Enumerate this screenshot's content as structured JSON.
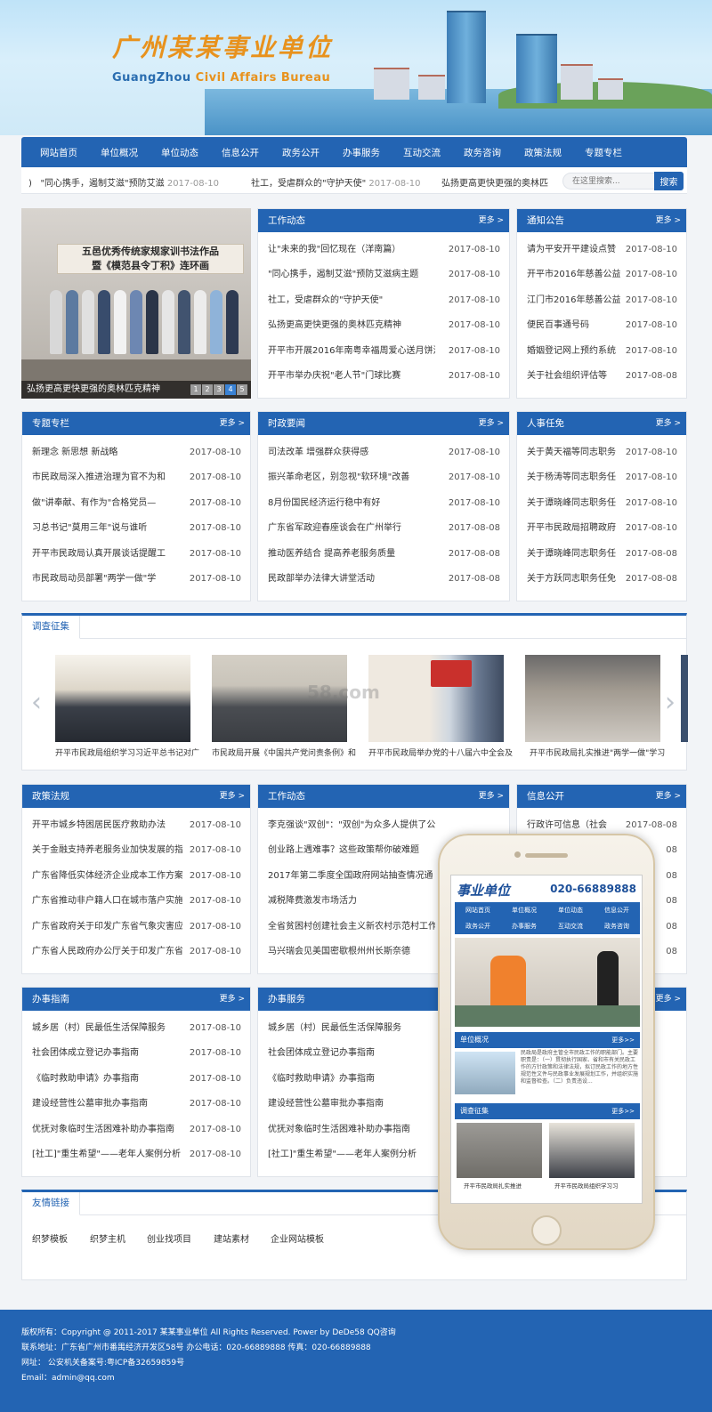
{
  "site": {
    "logo_cn": "广州某某事业单位",
    "logo_en_a": "GuangZhou",
    "logo_en_b": " Civil Affairs Bureau"
  },
  "nav": [
    "网站首页",
    "单位概况",
    "单位动态",
    "信息公开",
    "政务公开",
    "办事服务",
    "互动交流",
    "政务咨询",
    "政策法规",
    "专题专栏"
  ],
  "ticker": [
    {
      "title": "\"同心携手，遏制艾滋\"预防艾滋",
      "date": "2017-08-10"
    },
    {
      "title": "社工，受虐群众的\"守护天使\"",
      "date": "2017-08-10"
    },
    {
      "title": "弘扬更高更快更强的奥林匹",
      "date": ""
    }
  ],
  "search": {
    "placeholder": "在这里搜索...",
    "button": "搜索"
  },
  "slideshow": {
    "banner_line1": "五邑优秀传统家规家训书法作品",
    "banner_line2": "暨《模范县令丁积》连环画",
    "caption": "弘扬更高更快更强的奥林匹克精神",
    "pages": [
      "1",
      "2",
      "3",
      "4",
      "5"
    ],
    "active_page": "4"
  },
  "more_label": "更多 >",
  "panels": {
    "gzdt": {
      "title": "工作动态",
      "items": [
        {
          "t": "让\"未来的我\"回忆现在（洋南篇）",
          "d": "2017-08-10"
        },
        {
          "t": "\"同心携手，遏制艾滋\"预防艾滋病主题",
          "d": "2017-08-10"
        },
        {
          "t": "社工，受虐群众的\"守护天使\"",
          "d": "2017-08-10"
        },
        {
          "t": "弘扬更高更快更强的奥林匹克精神",
          "d": "2017-08-10"
        },
        {
          "t": "开平市开展2016年南粤幸福周爱心送月饼活",
          "d": "2017-08-10"
        },
        {
          "t": "开平市举办庆祝\"老人节\"门球比赛",
          "d": "2017-08-10"
        }
      ]
    },
    "tzgg": {
      "title": "通知公告",
      "items": [
        {
          "t": "请为平安开平建设点赞",
          "d": "2017-08-10"
        },
        {
          "t": "开平市2016年慈善公益",
          "d": "2017-08-10"
        },
        {
          "t": "江门市2016年慈善公益",
          "d": "2017-08-10"
        },
        {
          "t": "便民百事通号码",
          "d": "2017-08-10"
        },
        {
          "t": "婚姻登记网上预约系统",
          "d": "2017-08-10"
        },
        {
          "t": "关于社会组织评估等",
          "d": "2017-08-08"
        }
      ]
    },
    "ztzl": {
      "title": "专题专栏",
      "items": [
        {
          "t": "新理念 新思想 新战略",
          "d": "2017-08-10"
        },
        {
          "t": "市民政局深入推进治理为官不为和",
          "d": "2017-08-10"
        },
        {
          "t": "做\"讲奉献、有作为\"合格党员—",
          "d": "2017-08-10"
        },
        {
          "t": "习总书记\"莫用三年\"说与谁听",
          "d": "2017-08-10"
        },
        {
          "t": "开平市民政局认真开展谈话提醒工",
          "d": "2017-08-10"
        },
        {
          "t": "市民政局动员部署\"两学一做\"学",
          "d": "2017-08-10"
        }
      ]
    },
    "szyw": {
      "title": "时政要闻",
      "items": [
        {
          "t": "司法改革 增强群众获得感",
          "d": "2017-08-10"
        },
        {
          "t": "振兴革命老区，别忽视\"软环境\"改善",
          "d": "2017-08-10"
        },
        {
          "t": "8月份国民经济运行稳中有好",
          "d": "2017-08-10"
        },
        {
          "t": "广东省军政迎春座谈会在广州举行",
          "d": "2017-08-08"
        },
        {
          "t": "推动医养结合 提高养老服务质量",
          "d": "2017-08-08"
        },
        {
          "t": "民政部举办法律大讲堂活动",
          "d": "2017-08-08"
        }
      ]
    },
    "rsrm": {
      "title": "人事任免",
      "items": [
        {
          "t": "关于黄天福等同志职务",
          "d": "2017-08-10"
        },
        {
          "t": "关于杨涛等同志职务任",
          "d": "2017-08-10"
        },
        {
          "t": "关于谭晓峰同志职务任",
          "d": "2017-08-10"
        },
        {
          "t": "开平市民政局招聘政府",
          "d": "2017-08-10"
        },
        {
          "t": "关于谭晓峰同志职务任",
          "d": "2017-08-08"
        },
        {
          "t": "关于方跃同志职务任免",
          "d": "2017-08-08"
        }
      ]
    },
    "zcfg": {
      "title": "政策法规",
      "items": [
        {
          "t": "开平市城乡特困居民医疗救助办法",
          "d": "2017-08-10"
        },
        {
          "t": "关于金融支持养老服务业加快发展的指",
          "d": "2017-08-10"
        },
        {
          "t": "广东省降低实体经济企业成本工作方案",
          "d": "2017-08-10"
        },
        {
          "t": "广东省推动非户籍人口在城市落户实施",
          "d": "2017-08-10"
        },
        {
          "t": "广东省政府关于印发广东省气象灾害应",
          "d": "2017-08-10"
        },
        {
          "t": "广东省人民政府办公厅关于印发广东省",
          "d": "2017-08-10"
        }
      ]
    },
    "gzdt2": {
      "title": "工作动态",
      "items": [
        {
          "t": "李克强谈\"双创\"：\"双创\"为众多人提供了公平竞争的机会",
          "d": ""
        },
        {
          "t": "创业路上遇难事？这些政策帮你破难题",
          "d": ""
        },
        {
          "t": "2017年第二季度全国政府网站抽查情况通",
          "d": ""
        },
        {
          "t": "减税降费激发市场活力",
          "d": ""
        },
        {
          "t": "全省贫困村创建社会主义新农村示范村工作",
          "d": ""
        },
        {
          "t": "马兴瑞会见美国密歇根州州长斯奈德",
          "d": ""
        }
      ]
    },
    "xxgk": {
      "title": "信息公开",
      "items": [
        {
          "t": "行政许可信息（社会",
          "d": "2017-08-08"
        },
        {
          "t": "",
          "d": "08"
        },
        {
          "t": "",
          "d": "08"
        },
        {
          "t": "",
          "d": "08"
        },
        {
          "t": "",
          "d": "08"
        },
        {
          "t": "",
          "d": "08"
        }
      ]
    },
    "bszn": {
      "title": "办事指南",
      "items": [
        {
          "t": "城乡居（村）民最低生活保障服务",
          "d": "2017-08-10"
        },
        {
          "t": "社会团体成立登记办事指南",
          "d": "2017-08-10"
        },
        {
          "t": "《临时救助申请》办事指南",
          "d": "2017-08-10"
        },
        {
          "t": "建设经营性公墓审批办事指南",
          "d": "2017-08-10"
        },
        {
          "t": "优抚对象临时生活困难补助办事指南",
          "d": "2017-08-10"
        },
        {
          "t": "[社工]\"重生希望\"——老年人案例分析",
          "d": "2017-08-10"
        }
      ]
    },
    "bsfw": {
      "title": "办事服务",
      "items": [
        {
          "t": "城乡居（村）民最低生活保障服务",
          "d": ""
        },
        {
          "t": "社会团体成立登记办事指南",
          "d": ""
        },
        {
          "t": "《临时救助申请》办事指南",
          "d": ""
        },
        {
          "t": "建设经营性公墓审批办事指南",
          "d": ""
        },
        {
          "t": "优抚对象临时生活困难补助办事指南",
          "d": ""
        },
        {
          "t": "[社工]\"重生希望\"——老年人案例分析",
          "d": ""
        }
      ]
    }
  },
  "survey": {
    "tab": "调查征集",
    "watermark": "58.com",
    "captions": [
      "开平市民政局组织学习习近平总书记对广",
      "市民政局开展《中国共产党问责条例》和",
      "开平市民政局举办党的十八届六中全会及",
      "开平市民政局扎实推进\"两学一做\"学习"
    ]
  },
  "links": {
    "tab": "友情链接",
    "items": [
      "织梦模板",
      "织梦主机",
      "创业找项目",
      "建站素材",
      "企业网站模板"
    ]
  },
  "footer": {
    "line1": "版权所有：Copyright @ 2011-2017 某某事业单位 All Rights Reserved. Power by DeDe58    QQ咨询",
    "line2": "联系地址：广东省广州市番禺经济开发区58号   办公电话：020-66889888   传真：020-66889888",
    "line3": "网址：   公安机关备案号:粤ICP备32659859号",
    "line4": "Email：admin@qq.com"
  },
  "phone": {
    "title": "事业单位",
    "tel": "020-66889888",
    "nav": [
      "网站首页",
      "单位概况",
      "单位动态",
      "信息公开",
      "政务公开",
      "办事服务",
      "互动交流",
      "政务咨询"
    ],
    "section1": "单位概况",
    "intro": "民政局是政府主管全市民政工作的职能部门。主要职责是：（一）贯彻执行国家、省和市有关民政工作的方针政策和法律法规，拟订民政工作的地方性规范性文件与民政事业发展规划工作，并组织实施和监督检查。（二）负责违设...",
    "section2": "调查征集",
    "more": "更多>>",
    "cap1": "开平市民政局扎实推进",
    "cap2": "开平市民政局组织学习习"
  }
}
